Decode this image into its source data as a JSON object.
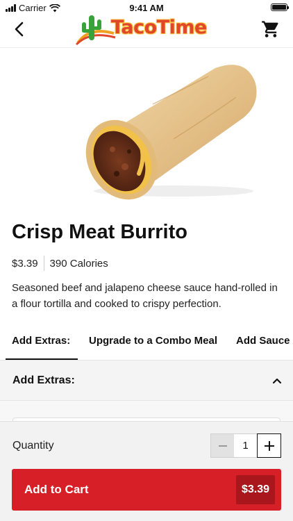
{
  "status_bar": {
    "carrier": "Carrier",
    "time": "9:41 AM"
  },
  "nav": {
    "logo_text": "TacoTime",
    "back_icon": "chevron-left-icon",
    "cart_icon": "shopping-cart-icon"
  },
  "product": {
    "name": "Crisp Meat Burrito",
    "price": "$3.39",
    "calories": "390 Calories",
    "description": "Seasoned beef and jalapeno cheese sauce hand-rolled in a flour tortilla and cooked to crispy perfection."
  },
  "tabs": [
    {
      "label": "Add Extras:",
      "active": true
    },
    {
      "label": "Upgrade to a Combo Meal",
      "active": false
    },
    {
      "label": "Add Sauce",
      "active": false
    }
  ],
  "section": {
    "title": "Add Extras:",
    "icon": "chevron-up-icon"
  },
  "order": {
    "quantity_label": "Quantity",
    "quantity": "1",
    "add_label": "Add to Cart",
    "total": "$3.39"
  },
  "colors": {
    "brand_red": "#d61f26",
    "price_chip": "#a9171c",
    "logo_red": "#e0462a",
    "logo_yellow": "#f7c545",
    "cactus_green": "#3aa23a"
  }
}
